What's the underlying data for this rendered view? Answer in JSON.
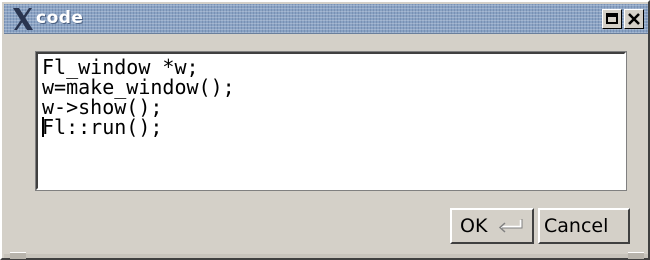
{
  "window": {
    "title": "code",
    "icons": {
      "title": "x-logo-icon",
      "maximize": "maximize-icon",
      "close": "close-icon"
    }
  },
  "editor": {
    "lines": [
      "Fl_window *w;",
      "w=make_window();",
      "w->show();",
      "Fl::run();"
    ]
  },
  "buttons": {
    "ok_label": "OK",
    "ok_icon": "return-key-icon",
    "cancel_label": "Cancel"
  },
  "colors": {
    "titlebar": "#8aa3c4",
    "window_bg": "#d4d0c8",
    "editor_bg": "#ffffff"
  }
}
